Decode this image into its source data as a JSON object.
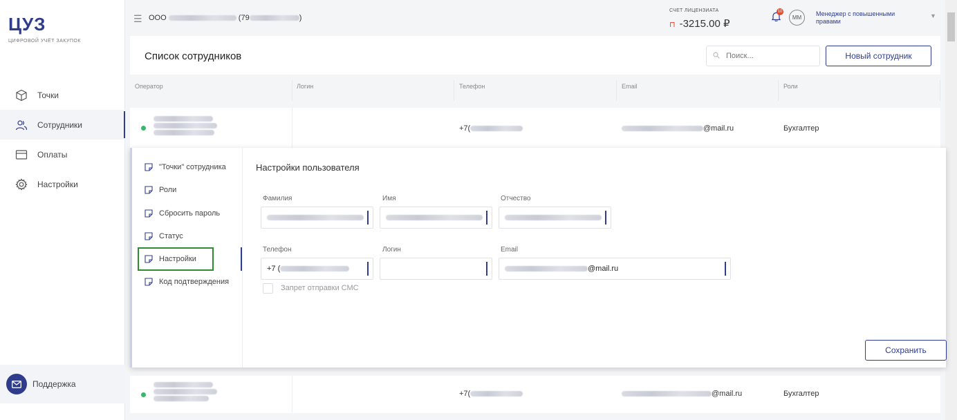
{
  "app": {
    "logo": "ЦУЗ",
    "tagline": "ЦИФРОВОЙ УЧЁТ ЗАКУПОК"
  },
  "sidebar": {
    "items": [
      {
        "label": "Точки",
        "icon": "cube-icon"
      },
      {
        "label": "Сотрудники",
        "icon": "users-icon"
      },
      {
        "label": "Оплаты",
        "icon": "card-icon"
      },
      {
        "label": "Настройки",
        "icon": "gear-icon"
      }
    ],
    "support_label": "Поддержка"
  },
  "header": {
    "org_prefix": "ООО",
    "org_suffix": "(79",
    "org_end": ")",
    "account_label": "СЧЕТ ЛИЦЕНЗИАТА",
    "account_value": "-3215.00 ₽",
    "notifications": "10",
    "avatar": "ММ",
    "user_role": "Менеджер с повышенными правами"
  },
  "page": {
    "title": "Список сотрудников",
    "search_placeholder": "Поиск...",
    "new_button": "Новый сотрудник"
  },
  "table": {
    "columns": [
      "Оператор",
      "Логин",
      "Телефон",
      "Email",
      "Роли"
    ],
    "rows": [
      {
        "phone_prefix": "+7(",
        "email_suffix": "@mail.ru",
        "role": "Бухгалтер"
      },
      {
        "phone_prefix": "+7(",
        "email_suffix": "@mail.ru",
        "role": "Бухгалтер"
      }
    ]
  },
  "details": {
    "menu": [
      "\"Точки\" сотрудника",
      "Роли",
      "Сбросить пароль",
      "Статус",
      "Настройки",
      "Код подтверждения"
    ],
    "active": "Настройки",
    "title": "Настройки пользователя",
    "fields": {
      "last_name": "Фамилия",
      "first_name": "Имя",
      "patronymic": "Отчество",
      "phone": "Телефон",
      "login": "Логин",
      "email": "Email"
    },
    "phone_value": "+7 (",
    "email_value": "@mail.ru",
    "sms_block_label": "Запрет отправки СМС",
    "save_button": "Сохранить"
  },
  "colors": {
    "accent": "#2f3c8c",
    "status_active": "#3cb66b",
    "warning": "#e03a2f"
  }
}
